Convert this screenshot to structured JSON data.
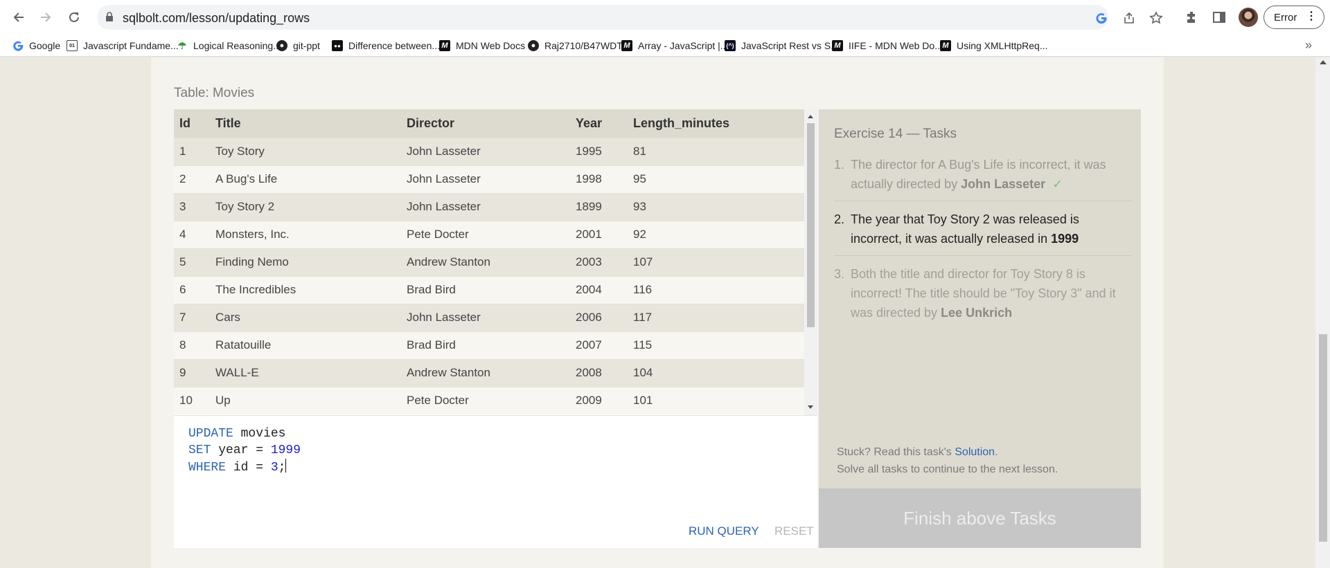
{
  "browser": {
    "url": "sqlbolt.com/lesson/updating_rows",
    "profile_button": "Error",
    "bookmarks": [
      {
        "label": "Google",
        "icon": "google-icon"
      },
      {
        "label": "Javascript Fundame...",
        "icon": "doc-icon"
      },
      {
        "label": "Logical Reasoning...",
        "icon": "umbrella-icon"
      },
      {
        "label": "git-ppt",
        "icon": "github-icon"
      },
      {
        "label": "Difference between...",
        "icon": "dev-icon"
      },
      {
        "label": "MDN Web Docs",
        "icon": "mdn-icon"
      },
      {
        "label": "Raj2710/B47WDT",
        "icon": "github-icon"
      },
      {
        "label": "Array - JavaScript |...",
        "icon": "mdn-icon"
      },
      {
        "label": "JavaScript Rest vs S...",
        "icon": "freecodecamp-icon"
      },
      {
        "label": "IIFE - MDN Web Do...",
        "icon": "mdn-icon"
      },
      {
        "label": "Using XMLHttpReq...",
        "icon": "mdn-icon"
      }
    ],
    "bookmarks_more": "»"
  },
  "table": {
    "caption": "Table: Movies",
    "columns": [
      "Id",
      "Title",
      "Director",
      "Year",
      "Length_minutes"
    ],
    "rows": [
      [
        "1",
        "Toy Story",
        "John Lasseter",
        "1995",
        "81"
      ],
      [
        "2",
        "A Bug's Life",
        "John Lasseter",
        "1998",
        "95"
      ],
      [
        "3",
        "Toy Story 2",
        "John Lasseter",
        "1899",
        "93"
      ],
      [
        "4",
        "Monsters, Inc.",
        "Pete Docter",
        "2001",
        "92"
      ],
      [
        "5",
        "Finding Nemo",
        "Andrew Stanton",
        "2003",
        "107"
      ],
      [
        "6",
        "The Incredibles",
        "Brad Bird",
        "2004",
        "116"
      ],
      [
        "7",
        "Cars",
        "John Lasseter",
        "2006",
        "117"
      ],
      [
        "8",
        "Ratatouille",
        "Brad Bird",
        "2007",
        "115"
      ],
      [
        "9",
        "WALL-E",
        "Andrew Stanton",
        "2008",
        "104"
      ],
      [
        "10",
        "Up",
        "Pete Docter",
        "2009",
        "101"
      ]
    ]
  },
  "editor": {
    "line1_kw": "UPDATE",
    "line1_rest": " movies",
    "line2_kw": "SET",
    "line2_rest": " year = ",
    "line2_num": "1999",
    "line3_kw": "WHERE",
    "line3_rest": " id = ",
    "line3_num": "3",
    "line3_end": ";",
    "run_label": "RUN QUERY",
    "reset_label": "RESET"
  },
  "tasks": {
    "title": "Exercise 14 — Tasks",
    "items": [
      {
        "num": "1.",
        "text": "The director for A Bug's Life is incorrect, it was actually directed by ",
        "bold": "John Lasseter",
        "check": "✓",
        "state": "done"
      },
      {
        "num": "2.",
        "text": "The year that Toy Story 2 was released is incorrect, it was actually released in ",
        "bold": "1999",
        "state": "active"
      },
      {
        "num": "3.",
        "text": "Both the title and director for Toy Story 8 is incorrect! The title should be \"Toy Story 3\" and it was directed by ",
        "bold": "Lee Unkrich",
        "state": "pending"
      }
    ],
    "stuck_prefix": "Stuck? Read this task's ",
    "solution_link": "Solution",
    "stuck_suffix": ".",
    "solve_all": "Solve all tasks to continue to the next lesson.",
    "finish_label": "Finish above Tasks"
  }
}
